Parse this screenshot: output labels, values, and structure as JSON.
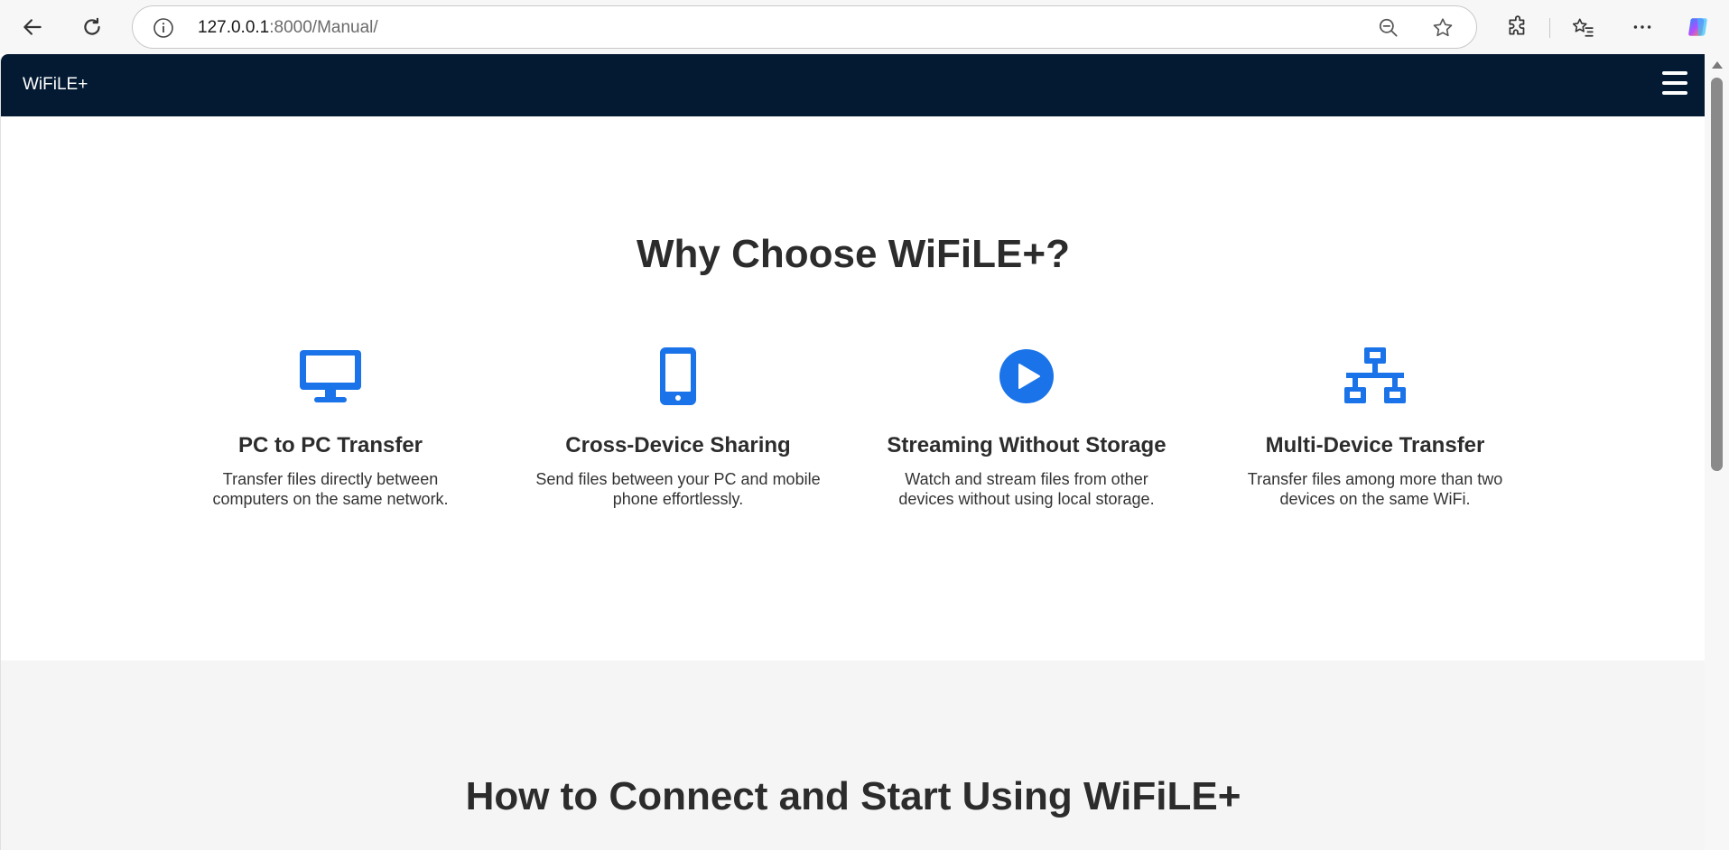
{
  "browser": {
    "url_host": "127.0.0.1",
    "url_path": ":8000/Manual/",
    "icons": [
      "back-arrow-icon",
      "reload-icon",
      "info-icon",
      "zoom-out-icon",
      "favorite-star-icon",
      "extensions-icon",
      "favorites-list-icon",
      "more-options-icon",
      "copilot-icon"
    ]
  },
  "app": {
    "brand": "WiFiLE+",
    "menu_icon": "hamburger-menu-icon",
    "accent_color": "#1a73e8",
    "header_color": "#041a33"
  },
  "why": {
    "title": "Why Choose WiFiLE+?",
    "features": [
      {
        "icon": "desktop-monitor-icon",
        "title": "PC to PC Transfer",
        "desc": "Transfer files directly between computers on the same network."
      },
      {
        "icon": "mobile-phone-icon",
        "title": "Cross-Device Sharing",
        "desc": "Send files between your PC and mobile phone effortlessly."
      },
      {
        "icon": "play-circle-icon",
        "title": "Streaming Without Storage",
        "desc": "Watch and stream files from other devices without using local storage."
      },
      {
        "icon": "network-icon",
        "title": "Multi-Device Transfer",
        "desc": "Transfer files among more than two devices on the same WiFi."
      }
    ]
  },
  "how": {
    "title": "How to Connect and Start Using WiFiLE+"
  }
}
